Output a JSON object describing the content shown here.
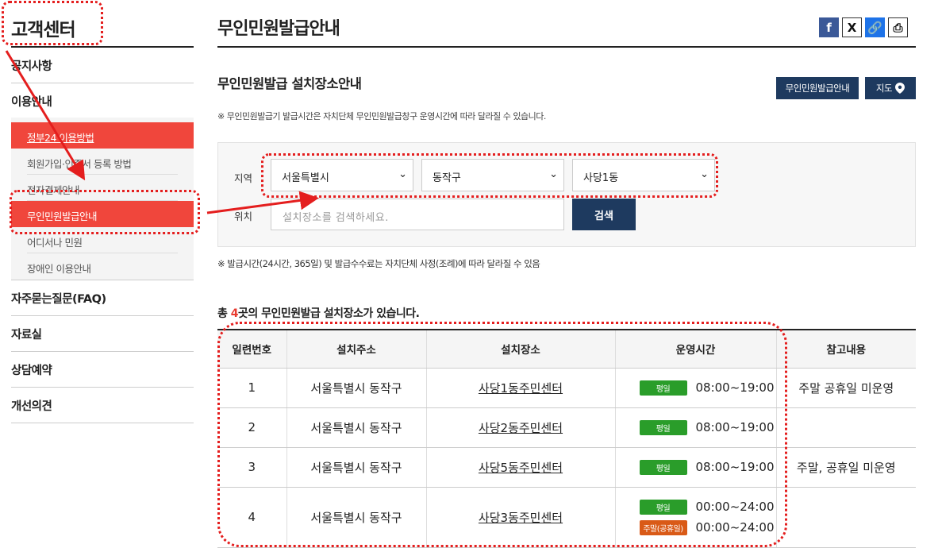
{
  "sidebar": {
    "title": "고객센터",
    "items": [
      {
        "label": "공지사항"
      },
      {
        "label": "이용안내"
      },
      {
        "label": "자주묻는질문(FAQ)"
      },
      {
        "label": "자료실"
      },
      {
        "label": "상담예약"
      },
      {
        "label": "개선의견"
      }
    ],
    "subitems": [
      {
        "label": "정부24 이용방법"
      },
      {
        "label": "회원가입·인증서 등록 방법"
      },
      {
        "label": "전자결제안내"
      },
      {
        "label": "무인민원발급안내"
      },
      {
        "label": "어디서나 민원"
      },
      {
        "label": "장애인 이용안내"
      }
    ]
  },
  "page": {
    "title": "무인민원발급안내",
    "section_title": "무인민원발급 설치장소안내",
    "btn_kiosk": "무인민원발급안내",
    "btn_map": "지도",
    "notice1": "※ 무인민원발급기 발급시간은 자치단체 무인민원발급창구 운영시간에 따라 달라질 수 있습니다.",
    "notice2": "※ 발급시간(24시간, 365일) 및 발급수수료는 자치단체 사정(조례)에 따라 달라질 수 있음"
  },
  "share": {
    "facebook": "f",
    "x": "X",
    "link": "🔗",
    "print": "⎙"
  },
  "search": {
    "region_label": "지역",
    "location_label": "위치",
    "sido": "서울특별시",
    "sigungu": "동작구",
    "dong": "사당1동",
    "placeholder": "설치장소를 검색하세요.",
    "button": "검색"
  },
  "results": {
    "prefix": "총 ",
    "count": "4",
    "suffix": "곳의 무인민원발급 설치장소가 있습니다."
  },
  "table": {
    "headers": [
      "일련번호",
      "설치주소",
      "설치장소",
      "운영시간",
      "참고내용"
    ],
    "rows": [
      {
        "no": "1",
        "address": "서울특별시 동작구",
        "place": "사당1동주민센터",
        "hours": [
          {
            "badge": "평일",
            "time": "08:00~19:00"
          }
        ],
        "note": "주말 공휴일 미운영"
      },
      {
        "no": "2",
        "address": "서울특별시 동작구",
        "place": "사당2동주민센터",
        "hours": [
          {
            "badge": "평일",
            "time": "08:00~19:00"
          }
        ],
        "note": ""
      },
      {
        "no": "3",
        "address": "서울특별시 동작구",
        "place": "사당5동주민센터",
        "hours": [
          {
            "badge": "평일",
            "time": "08:00~19:00"
          }
        ],
        "note": "주말, 공휴일 미운영"
      },
      {
        "no": "4",
        "address": "서울특별시 동작구",
        "place": "사당3동주민센터",
        "hours": [
          {
            "badge": "평일",
            "time": "00:00~24:00"
          },
          {
            "badge": "주말(공휴일)",
            "time": "00:00~24:00"
          }
        ],
        "note": ""
      }
    ]
  },
  "colors": {
    "accent_red": "#f0463c",
    "navy": "#1e3a5f",
    "weekday_green": "#2a9d2a",
    "weekend_orange": "#d95a17",
    "annotation_red": "#e41e1e"
  }
}
